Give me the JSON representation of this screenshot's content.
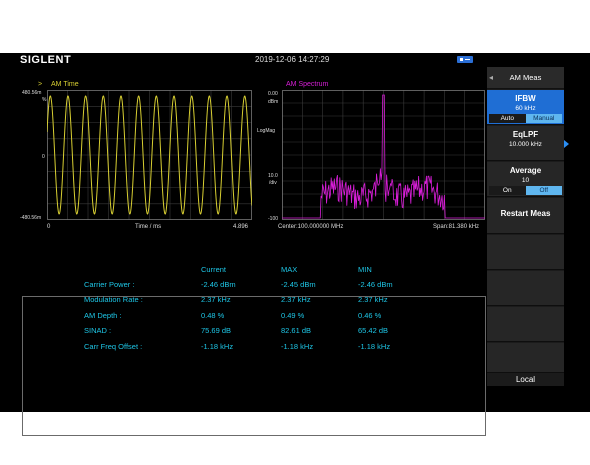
{
  "header": {
    "brand": "SIGLENT",
    "datetime": "2019-12-06 14:27:29"
  },
  "time_panel": {
    "marker": ">",
    "title": "AM  Time",
    "y_top": "480.56m",
    "y_unit": "%",
    "y_mid": "0",
    "y_bottom": "-480.56m",
    "x_start": "0",
    "x_label": "Time / ms",
    "x_end": "4.896",
    "color": "#d8cf32"
  },
  "spectrum_panel": {
    "title": "AM  Spectrum",
    "y_top": "0.00",
    "y_top_unit": "dBm",
    "y_scale": "LogMag",
    "y_div": "10.0",
    "y_div_unit": "/div",
    "y_bottom": "-100",
    "center": "Center:100.000000 MHz",
    "span": "Span:81.380 kHz",
    "color": "#d81ed8"
  },
  "results": {
    "columns": [
      "Current",
      "MAX",
      "MIN"
    ],
    "rows": [
      {
        "label": "Carrier Power :",
        "current": "-2.46 dBm",
        "max": "-2.45 dBm",
        "min": "-2.46 dBm"
      },
      {
        "label": "Modulation Rate :",
        "current": "2.37 kHz",
        "max": "2.37 kHz",
        "min": "2.37 kHz"
      },
      {
        "label": "AM Depth :",
        "current": "0.48 %",
        "max": "0.49 %",
        "min": "0.46 %"
      },
      {
        "label": "SINAD :",
        "current": "75.69 dB",
        "max": "82.61 dB",
        "min": "65.42 dB"
      },
      {
        "label": "Carr Freq Offset :",
        "current": "-1.18 kHz",
        "max": "-1.18 kHz",
        "min": "-1.18 kHz"
      }
    ]
  },
  "menu": {
    "back": "◂",
    "title": "AM Meas",
    "ifbw": {
      "title": "IFBW",
      "value": "60 kHz",
      "opt_a": "Auto",
      "opt_b": "Manual",
      "selected": "Manual"
    },
    "eqlpf": {
      "title": "EqLPF",
      "value": "10.000 kHz"
    },
    "average": {
      "title": "Average",
      "value": "10",
      "opt_a": "On",
      "opt_b": "Off",
      "selected": "Off"
    },
    "restart": "Restart Meas",
    "local": "Local"
  }
}
